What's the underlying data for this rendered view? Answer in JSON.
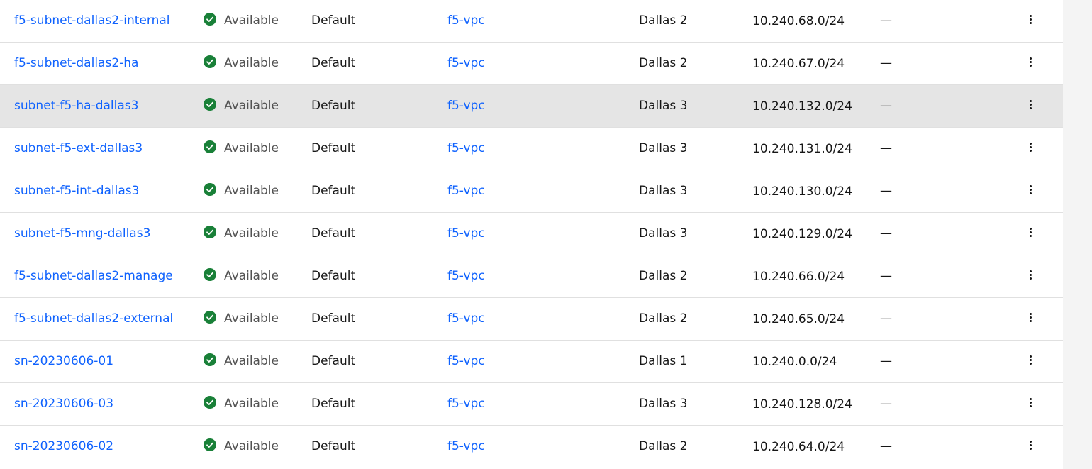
{
  "colors": {
    "link": "#0f62fe",
    "status_available": "#198038",
    "row_hover": "#e5e5e5"
  },
  "icons": {
    "status": "checkmark-filled-icon",
    "row_menu": "overflow-menu-vertical-icon"
  },
  "rows": [
    {
      "name": "f5-subnet-dallas2-internal",
      "status": "Available",
      "acl": "Default",
      "vpc": "f5-vpc",
      "zone": "Dallas 2",
      "cidr": "10.240.68.0/24",
      "gateway": "—",
      "hovered": false
    },
    {
      "name": "f5-subnet-dallas2-ha",
      "status": "Available",
      "acl": "Default",
      "vpc": "f5-vpc",
      "zone": "Dallas 2",
      "cidr": "10.240.67.0/24",
      "gateway": "—",
      "hovered": false
    },
    {
      "name": "subnet-f5-ha-dallas3",
      "status": "Available",
      "acl": "Default",
      "vpc": "f5-vpc",
      "zone": "Dallas 3",
      "cidr": "10.240.132.0/24",
      "gateway": "—",
      "hovered": true
    },
    {
      "name": "subnet-f5-ext-dallas3",
      "status": "Available",
      "acl": "Default",
      "vpc": "f5-vpc",
      "zone": "Dallas 3",
      "cidr": "10.240.131.0/24",
      "gateway": "—",
      "hovered": false
    },
    {
      "name": "subnet-f5-int-dallas3",
      "status": "Available",
      "acl": "Default",
      "vpc": "f5-vpc",
      "zone": "Dallas 3",
      "cidr": "10.240.130.0/24",
      "gateway": "—",
      "hovered": false
    },
    {
      "name": "subnet-f5-mng-dallas3",
      "status": "Available",
      "acl": "Default",
      "vpc": "f5-vpc",
      "zone": "Dallas 3",
      "cidr": "10.240.129.0/24",
      "gateway": "—",
      "hovered": false
    },
    {
      "name": "f5-subnet-dallas2-manage",
      "status": "Available",
      "acl": "Default",
      "vpc": "f5-vpc",
      "zone": "Dallas 2",
      "cidr": "10.240.66.0/24",
      "gateway": "—",
      "hovered": false
    },
    {
      "name": "f5-subnet-dallas2-external",
      "status": "Available",
      "acl": "Default",
      "vpc": "f5-vpc",
      "zone": "Dallas 2",
      "cidr": "10.240.65.0/24",
      "gateway": "—",
      "hovered": false
    },
    {
      "name": "sn-20230606-01",
      "status": "Available",
      "acl": "Default",
      "vpc": "f5-vpc",
      "zone": "Dallas 1",
      "cidr": "10.240.0.0/24",
      "gateway": "—",
      "hovered": false
    },
    {
      "name": "sn-20230606-03",
      "status": "Available",
      "acl": "Default",
      "vpc": "f5-vpc",
      "zone": "Dallas 3",
      "cidr": "10.240.128.0/24",
      "gateway": "—",
      "hovered": false
    },
    {
      "name": "sn-20230606-02",
      "status": "Available",
      "acl": "Default",
      "vpc": "f5-vpc",
      "zone": "Dallas 2",
      "cidr": "10.240.64.0/24",
      "gateway": "—",
      "hovered": false
    }
  ]
}
